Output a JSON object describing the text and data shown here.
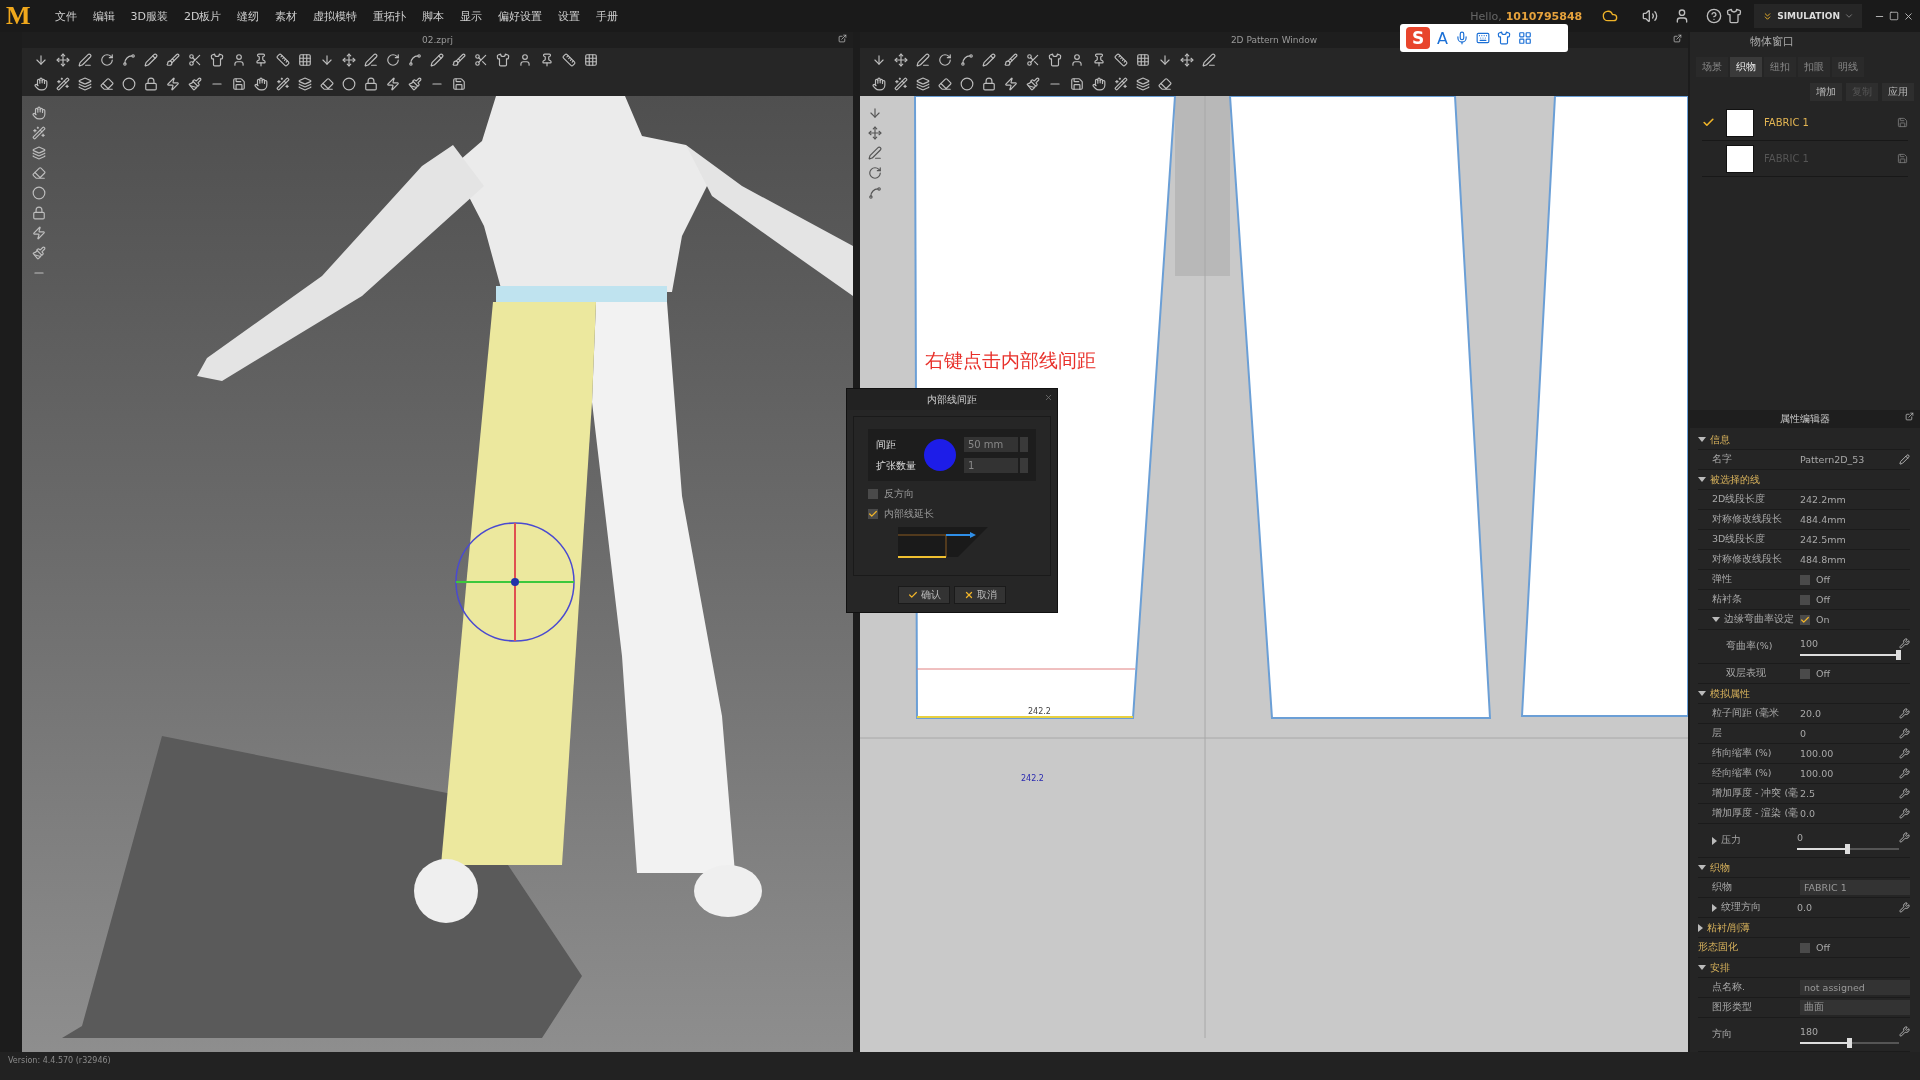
{
  "logo": "M",
  "menu": [
    "文件",
    "编辑",
    "3D服装",
    "2D板片",
    "缝纫",
    "素材",
    "虚拟模特",
    "重拓扑",
    "脚本",
    "显示",
    "偏好设置",
    "设置",
    "手册"
  ],
  "account": {
    "greeting": "Hello,",
    "id": "1010795848"
  },
  "mode": "SIMULATION",
  "ime": {
    "logo": "S",
    "mode": "A"
  },
  "viewport_3d": {
    "title": "02.zprj"
  },
  "pattern_window": {
    "title": "2D Pattern Window",
    "annotation": "右键点击内部线间距",
    "labels": [
      "242.2",
      "242.2"
    ]
  },
  "dialog": {
    "title": "内部线间距",
    "fields": [
      {
        "label": "间距",
        "value": "50",
        "unit": "mm"
      },
      {
        "label": "扩张数量",
        "value": "1"
      }
    ],
    "options": [
      {
        "label": "反方向",
        "checked": false
      },
      {
        "label": "内部线延长",
        "checked": true
      }
    ],
    "buttons": [
      {
        "label": "确认",
        "kind": "ok"
      },
      {
        "label": "取消",
        "kind": "cancel"
      }
    ]
  },
  "object_browser": {
    "title": "物体窗口",
    "tabs": [
      {
        "label": "场景",
        "selected": false
      },
      {
        "label": "织物",
        "selected": true
      },
      {
        "label": "纽扣",
        "selected": false
      },
      {
        "label": "扣眼",
        "selected": false
      },
      {
        "label": "明线",
        "selected": false
      }
    ],
    "buttons": [
      {
        "label": "增加",
        "disabled": false
      },
      {
        "label": "复制",
        "disabled": true
      },
      {
        "label": "应用",
        "disabled": false
      }
    ],
    "fabrics": [
      {
        "name": "FABRIC 1",
        "selected": true
      },
      {
        "name": "FABRIC 1",
        "selected": false
      }
    ]
  },
  "property_editor": {
    "title": "属性编辑器",
    "groups": [
      {
        "kind": "section",
        "title": "信息",
        "expanded": true,
        "rows": [
          {
            "kind": "name",
            "label": "名字",
            "value": "Pattern2D_53"
          }
        ]
      },
      {
        "kind": "section",
        "title": "被选择的线",
        "expanded": true,
        "rows": [
          {
            "kind": "value",
            "label": "2D线段长度",
            "value": "242.2mm"
          },
          {
            "kind": "value",
            "label": "对称修改线段长",
            "value": "484.4mm"
          },
          {
            "kind": "value",
            "label": "3D线段长度",
            "value": "242.5mm"
          },
          {
            "kind": "value",
            "label": "对称修改线段长",
            "value": "484.8mm"
          },
          {
            "kind": "check",
            "label": "弹性",
            "value": "Off",
            "checked": false
          },
          {
            "kind": "check",
            "label": "粘衬条",
            "value": "Off",
            "checked": false
          },
          {
            "kind": "check",
            "label": "边缘弯曲率设定",
            "value": "On",
            "checked": true,
            "expanded": true,
            "children": [
              {
                "kind": "slider",
                "label": "弯曲率(%)",
                "value": "100",
                "level": 1.0
              },
              {
                "kind": "check",
                "label": "双层表现",
                "value": "Off",
                "checked": false
              }
            ]
          }
        ]
      },
      {
        "kind": "section",
        "title": "模拟属性",
        "expanded": true,
        "rows": [
          {
            "kind": "value",
            "label": "粒子间距 (毫米",
            "value": "20.0",
            "editable": true
          },
          {
            "kind": "value",
            "label": "层",
            "value": "0",
            "editable": true
          },
          {
            "kind": "value",
            "label": "纬向缩率 (%)",
            "value": "100.00",
            "editable": true
          },
          {
            "kind": "value",
            "label": "经向缩率 (%)",
            "value": "100.00",
            "editable": true
          },
          {
            "kind": "value",
            "label": "增加厚度 - 冲突 (毫",
            "value": "2.5",
            "editable": true
          },
          {
            "kind": "value",
            "label": "增加厚度 - 渲染 (毫",
            "value": "0.0",
            "editable": true
          },
          {
            "kind": "slider",
            "label": "压力",
            "value": "0",
            "level": 0.5,
            "expanded": false
          }
        ]
      },
      {
        "kind": "section",
        "title": "织物",
        "expanded": true,
        "rows": [
          {
            "kind": "fabric",
            "label": "织物",
            "value": "FABRIC 1"
          },
          {
            "kind": "value",
            "label": "纹理方向",
            "value": "0.0",
            "editable": true,
            "expanded": false
          }
        ]
      },
      {
        "kind": "section",
        "title": "粘衬/削薄",
        "expanded": false
      },
      {
        "kind": "check",
        "label": "形态固化",
        "value": "Off",
        "checked": false
      },
      {
        "kind": "section",
        "title": "安排",
        "expanded": true,
        "rows": [
          {
            "kind": "select",
            "label": "点名称.",
            "value": "not assigned"
          },
          {
            "kind": "select",
            "label": "图形类型",
            "value": "曲面"
          },
          {
            "kind": "slider",
            "label": "方向",
            "value": "180",
            "level": 0.5
          }
        ]
      }
    ]
  },
  "status_bar": {
    "version": "Version: 4.4.570 (r32946)"
  }
}
